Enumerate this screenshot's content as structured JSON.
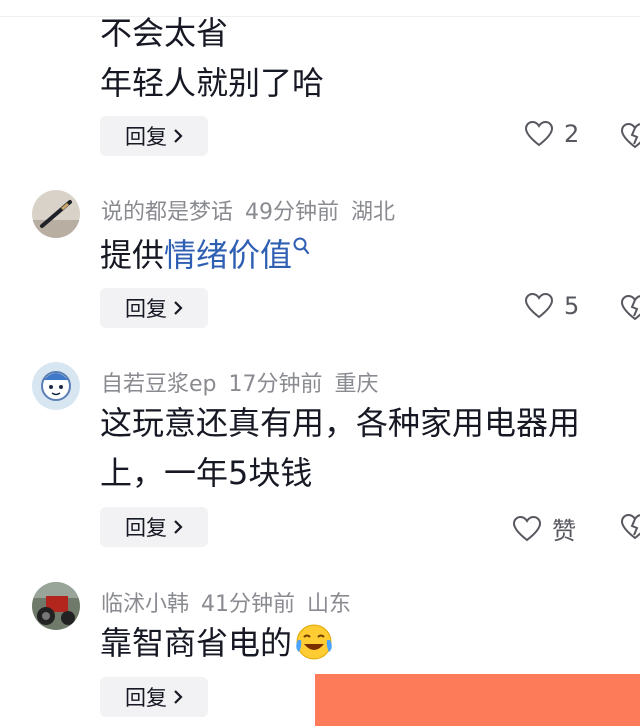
{
  "comments": [
    {
      "lines": [
        "不会太省",
        " 年轻人就别了哈"
      ],
      "reply_label": "回复",
      "like_count": "2"
    },
    {
      "user": "说的都是梦话",
      "time": "49分钟前",
      "location": "湖北",
      "text_plain": "提供",
      "text_link": "情绪价值",
      "reply_label": "回复",
      "like_count": "5"
    },
    {
      "user": "自若豆浆ep",
      "time": "17分钟前",
      "location": "重庆",
      "lines": [
        "这玩意还真有用，各种家用电器用",
        "上，一年5块钱"
      ],
      "reply_label": "回复",
      "like_count": "赞"
    },
    {
      "user": "临沭小韩",
      "time": "41分钟前",
      "location": "山东",
      "text": "靠智商省电的",
      "emoji": "laughing-crying-emoji",
      "reply_label": "回复"
    }
  ],
  "colors": {
    "meta_gray": "#8a8b91",
    "link_blue": "#2f5fb3",
    "reply_bg": "#f2f2f4",
    "accent_orange": "#fe7b5a"
  }
}
